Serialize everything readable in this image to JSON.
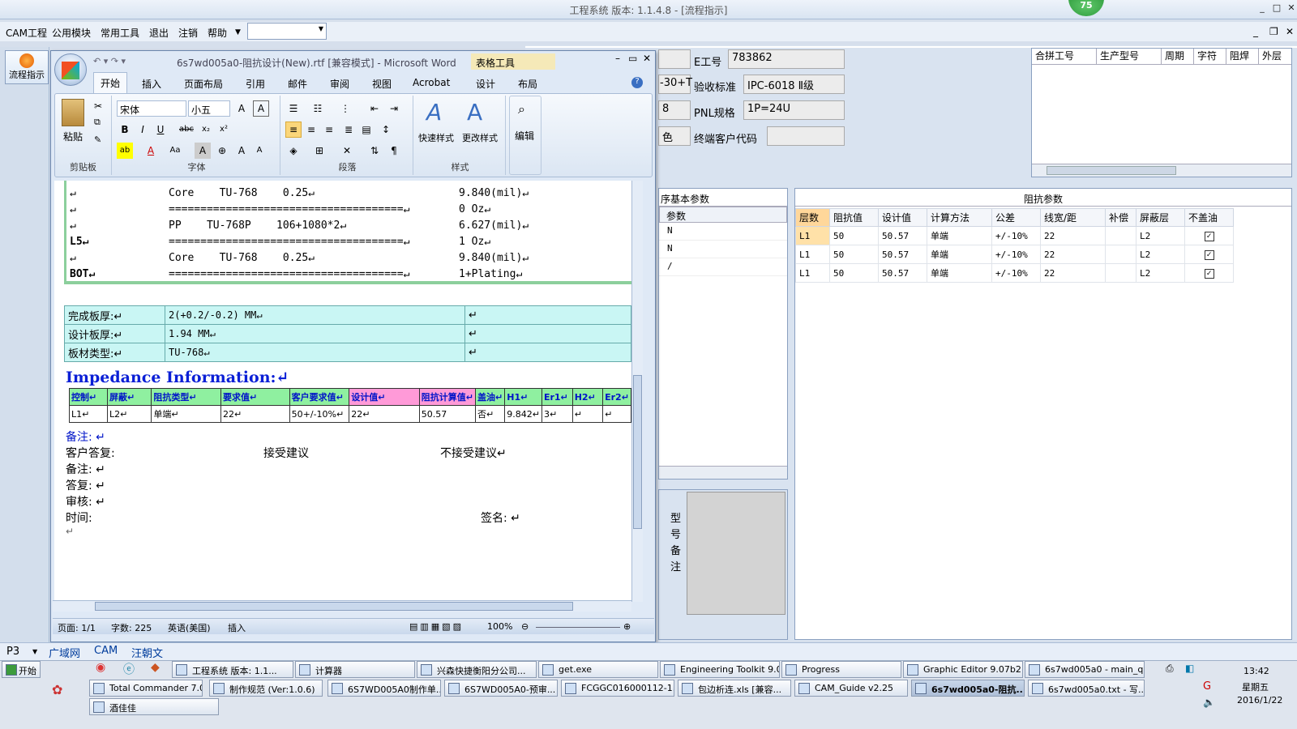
{
  "app": {
    "title": "工程系统  版本: 1.1.4.8 - [流程指示]",
    "badge": "75"
  },
  "menu": {
    "items": [
      "CAM工程",
      "公用模块",
      "常用工具",
      "退出",
      "注销",
      "帮助"
    ],
    "combo": ""
  },
  "left": {
    "flow_btn": "流程指示"
  },
  "info": {
    "e_label": "E工号",
    "e_value": "783862",
    "accept_label": "验收标准",
    "accept_value": "IPC-6018 Ⅱ级",
    "pnl_label": "PNL规格",
    "pnl_value": "1P=24U",
    "client_label": "终端客户代码",
    "client_value": "",
    "frag1": "-30+T",
    "frag2": "8",
    "frag3": "色"
  },
  "combine": {
    "headers": [
      "合拼工号",
      "生产型号",
      "周期",
      "字符",
      "阻焊",
      "外层"
    ]
  },
  "proc": {
    "title": "序基本参数",
    "col": "参数",
    "rows": [
      "N",
      "N",
      "/"
    ]
  },
  "model_note": {
    "label": "型号备注"
  },
  "imp": {
    "title": "阻抗参数",
    "headers": [
      "层数",
      "阻抗值",
      "设计值",
      "计算方法",
      "公差",
      "线宽/距",
      "补偿",
      "屏蔽层",
      "不盖油"
    ],
    "rows": [
      [
        "L1",
        "50",
        "50.57",
        "单端",
        "+/-10%",
        "22",
        "",
        "L2",
        "✓"
      ],
      [
        "L1",
        "50",
        "50.57",
        "单端",
        "+/-10%",
        "22",
        "",
        "L2",
        "✓"
      ],
      [
        "L1",
        "50",
        "50.57",
        "单端",
        "+/-10%",
        "22",
        "",
        "L2",
        "✓"
      ]
    ]
  },
  "word": {
    "title": "6s7wd005a0-阻抗设计(New).rtf [兼容模式] - Microsoft Word",
    "tools": "表格工具",
    "tabs": [
      "开始",
      "插入",
      "页面布局",
      "引用",
      "邮件",
      "审阅",
      "视图",
      "Acrobat",
      "设计",
      "布局"
    ],
    "groups": {
      "clipboard": "剪贴板",
      "font": "字体",
      "para": "段落",
      "style": "样式",
      "edit": "编辑"
    },
    "paste": "粘贴",
    "font_name": "宋体",
    "font_size": "小五",
    "quick_style": "快速样式",
    "change_style": "更改样式",
    "edit_btn": "编辑",
    "stack": [
      {
        "a": "↵",
        "b": "Core    TU-768    0.25↵",
        "c": "9.840(mil)↵"
      },
      {
        "a": "↵",
        "b": "=====================================↵",
        "c": "0 Oz↵"
      },
      {
        "a": "↵",
        "b": "PP    TU-768P    106+1080*2↵",
        "c": "6.627(mil)↵"
      },
      {
        "a": "L5↵",
        "b": "=====================================↵",
        "c": "1 Oz↵"
      },
      {
        "a": "↵",
        "b": "Core    TU-768    0.25↵",
        "c": "9.840(mil)↵"
      },
      {
        "a": "BOT↵",
        "b": "=====================================↵",
        "c": "1+Plating↵"
      }
    ],
    "info_rows": [
      [
        "完成板厚:↵",
        "2(+0.2/-0.2) MM↵",
        "↵"
      ],
      [
        "设计板厚:↵",
        "1.94 MM↵",
        "↵"
      ],
      [
        "板材类型:↵",
        "TU-768↵",
        "↵"
      ]
    ],
    "imp_title": "Impedance Information:↵",
    "imp_headers": [
      "控制↵",
      "屏蔽↵",
      "阻抗类型↵",
      "要求值↵",
      "客户要求值↵",
      "设计值↵",
      "阻抗计算值↵",
      "盖油↵",
      "H1↵",
      "Er1↵",
      "H2↵",
      "Er2↵"
    ],
    "imp_row": [
      "L1↵",
      "L2↵",
      "单端↵",
      "22↵",
      "50+/-10%↵",
      "22↵",
      "50.57",
      "否↵",
      "9.842↵",
      "3↵",
      "↵",
      "↵"
    ],
    "notes": {
      "n1": "备注: ↵",
      "client": "客户答复:",
      "accept": "接受建议",
      "reject": "不接受建议↵",
      "n2": "备注: ↵",
      "reply": "答复: ↵",
      "review": "审核: ↵",
      "time": "时间:",
      "sign": "签名: ↵",
      "end": "↵"
    },
    "status": {
      "page": "页面: 1/1",
      "words": "字数: 225",
      "lang": "英语(美国)",
      "mode": "插入",
      "zoom": "100%"
    }
  },
  "tabstrip": {
    "p3": "P3",
    "items": [
      "广域网",
      "CAM",
      "汪朝文"
    ]
  },
  "taskbar": {
    "start": "开始",
    "row1": [
      "工程系统  版本: 1.1...",
      "计算器",
      "兴森快捷衡阳分公司...",
      "get.exe",
      "Engineering Toolkit 9.0...",
      "Progress",
      "Graphic Editor 9.07b2 ...",
      "6s7wd005a0 - main_qa"
    ],
    "row2": [
      "Total Commander 7.0...",
      "制作规范 (Ver:1.0.6)",
      "6S7WD005A0制作单...",
      "6S7WD005A0-预审...",
      "FCGGC016000112-1...",
      "包边析连.xls [兼容...",
      "CAM_Guide v2.25",
      "6s7wd005a0-阻抗...",
      "6s7wd005a0.txt - 写..."
    ],
    "row3": [
      "酒佳佳"
    ],
    "time": "13:42",
    "weekday": "星期五",
    "date": "2016/1/22"
  }
}
